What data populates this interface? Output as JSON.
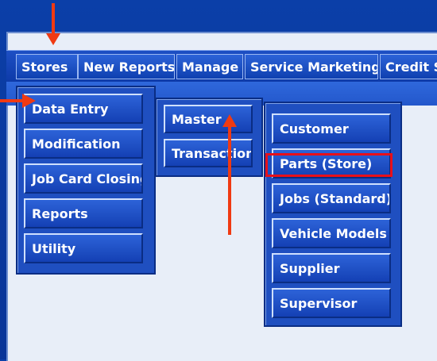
{
  "menubar": {
    "items": [
      {
        "label": "Stores"
      },
      {
        "label": "New Reports"
      },
      {
        "label": "Manage"
      },
      {
        "label": "Service Marketing"
      },
      {
        "label": "Credit Sy"
      }
    ]
  },
  "submenu_stores": {
    "items": [
      {
        "label": "Data Entry"
      },
      {
        "label": "Modification"
      },
      {
        "label": "Job Card Closing"
      },
      {
        "label": "Reports"
      },
      {
        "label": "Utility"
      }
    ]
  },
  "submenu_data_entry": {
    "items": [
      {
        "label": "Master"
      },
      {
        "label": "Transaction"
      }
    ]
  },
  "submenu_master": {
    "items": [
      {
        "label": "Customer"
      },
      {
        "label": "Parts (Store)"
      },
      {
        "label": "Jobs (Standard)"
      },
      {
        "label": "Vehicle Models"
      },
      {
        "label": "Supplier"
      },
      {
        "label": "Supervisor"
      }
    ]
  },
  "colors": {
    "menu_blue": "#1f4fc0",
    "highlight_red": "#e8101a",
    "arrow_orange": "#f03a12"
  }
}
